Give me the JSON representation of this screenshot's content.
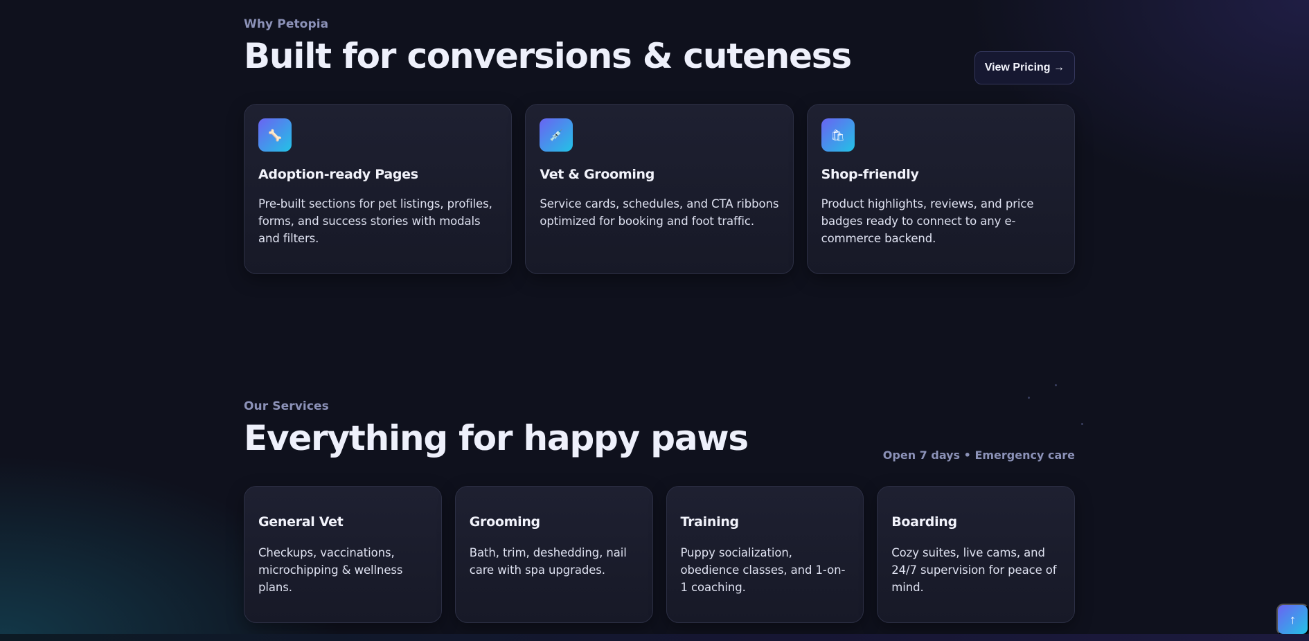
{
  "why": {
    "eyebrow": "Why Petopia",
    "heading": "Built for conversions & cuteness",
    "pricing_label": "View Pricing →",
    "cards": [
      {
        "icon": "bone-icon",
        "glyph": "🦴",
        "title": "Adoption-ready Pages",
        "text": "Pre-built sections for pet listings, profiles, forms, and success stories with modals and filters."
      },
      {
        "icon": "syringe-icon",
        "glyph": "💉",
        "title": "Vet & Grooming",
        "text": "Service cards, schedules, and CTA ribbons optimized for booking and foot traffic."
      },
      {
        "icon": "shopping-bag-icon",
        "glyph": "🛍",
        "title": "Shop-friendly",
        "text": "Product highlights, reviews, and price badges ready to connect to any e-commerce backend."
      }
    ]
  },
  "services": {
    "eyebrow": "Our Services",
    "heading": "Everything for happy paws",
    "note": "Open 7 days • Emergency care",
    "cards": [
      {
        "title": "General Vet",
        "text": "Checkups, vaccinations, microchipping & wellness plans."
      },
      {
        "title": "Grooming",
        "text": "Bath, trim, deshedding, nail care with spa upgrades."
      },
      {
        "title": "Training",
        "text": "Puppy socialization, obedience classes, and 1-on-1 coaching."
      },
      {
        "title": "Boarding",
        "text": "Cozy suites, live cams, and 24/7 supervision for peace of mind."
      }
    ]
  },
  "back_to_top": {
    "icon": "arrow-up-icon",
    "glyph": "↑"
  },
  "colors": {
    "accent_start": "#6a63f2",
    "accent_end": "#22c3e6",
    "background": "#0f111d"
  }
}
